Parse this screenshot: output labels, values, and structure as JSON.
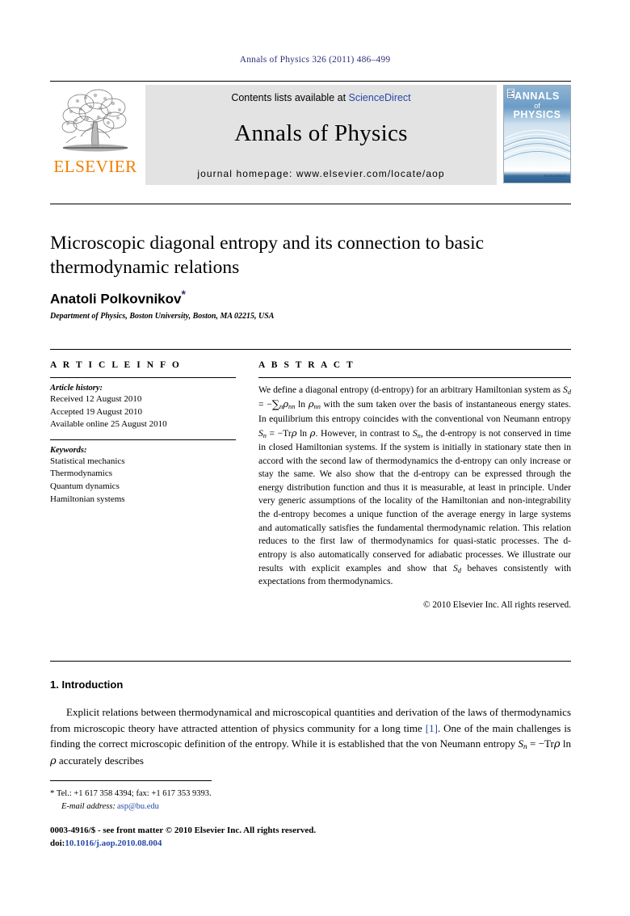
{
  "running_head": "Annals of Physics 326 (2011) 486–499",
  "masthead": {
    "contents_text": "Contents lists available at",
    "sciencedirect": "ScienceDirect",
    "journal_name": "Annals of Physics",
    "homepage_label": "journal homepage: www.elsevier.com/locate/aop",
    "publisher_wordmark": "ELSEVIER",
    "cover": {
      "line1": "ANNALS",
      "line2": "of",
      "line3": "PHYSICS",
      "badge": "ScienceDirect"
    }
  },
  "article": {
    "title": "Microscopic diagonal entropy and its connection to basic thermodynamic relations",
    "author": "Anatoli Polkovnikov",
    "author_marker": "*",
    "affiliation": "Department of Physics, Boston University, Boston, MA 02215, USA"
  },
  "info": {
    "heading": "A R T I C L E   I N F O",
    "history_label": "Article history:",
    "history": [
      "Received 12 August 2010",
      "Accepted 19 August 2010",
      "Available online 25 August 2010"
    ],
    "keywords_label": "Keywords:",
    "keywords": [
      "Statistical mechanics",
      "Thermodynamics",
      "Quantum dynamics",
      "Hamiltonian systems"
    ]
  },
  "abstract": {
    "heading": "A B S T R A C T",
    "part1": "We define a diagonal entropy (d-entropy) for an arbitrary Hamiltonian system as ",
    "formula1_lhs": "S",
    "formula1_lhs_sub": "d",
    "formula1_eq": " = −",
    "formula1_sum": "∑",
    "formula1_sum_sub": "n",
    "formula1_rho": "ρ",
    "formula1_rho_sub": "nn",
    "formula1_ln": " ln ",
    "formula1_rho2": "ρ",
    "formula1_rho2_sub": "nn",
    "part2": " with the sum taken over the basis of instantaneous energy states. In equilibrium this entropy coincides with the conventional von Neumann entropy ",
    "formula2_lhs": "S",
    "formula2_lhs_sub": "n",
    "formula2_eq": " = −Tr",
    "formula2_rho": "ρ",
    "formula2_ln": " ln ",
    "formula2_rho2": "ρ",
    "part3": ". However, in contrast to ",
    "formula3_lhs": "S",
    "formula3_lhs_sub": "n",
    "part4": ", the d-entropy is not conserved in time in closed Hamiltonian systems. If the system is initially in stationary state then in accord with the second law of thermodynamics the d-entropy can only increase or stay the same. We also show that the d-entropy can be expressed through the energy distribution function and thus it is measurable, at least in principle. Under very generic assumptions of the locality of the Hamiltonian and non-integrability the d-entropy becomes a unique function of the average energy in large systems and automatically satisfies the fundamental thermodynamic relation. This relation reduces to the first law of thermodynamics for quasi-static processes. The d-entropy is also automatically conserved for adiabatic processes. We illustrate our results with explicit examples and show that ",
    "formula4_lhs": "S",
    "formula4_lhs_sub": "d",
    "part5": " behaves consistently with expectations from thermodynamics.",
    "copyright": "© 2010 Elsevier Inc. All rights reserved."
  },
  "body": {
    "section_number_title": "1. Introduction",
    "paragraph_a": "Explicit relations between thermodynamical and microscopical quantities and derivation of the laws of thermodynamics from microscopic theory have attracted attention of physics community for a long time ",
    "citation": "[1]",
    "paragraph_b": ". One of the main challenges is finding the correct microscopic definition of the entropy. While it is established that the von Neumann entropy ",
    "formula_lhs": "S",
    "formula_lhs_sub": "n",
    "formula_eq": " = −Tr",
    "formula_rho": "ρ",
    "formula_ln": " ln ",
    "formula_rho2": "ρ",
    "paragraph_c": " accurately describes"
  },
  "footer": {
    "footnote_marker": "*",
    "footnote_contact": "Tel.: +1 617 358 4394; fax: +1 617 353 9393.",
    "email_label": "E-mail address:",
    "email": "asp@bu.edu",
    "issn_line": "0003-4916/$ - see front matter © 2010 Elsevier Inc. All rights reserved.",
    "doi_label": "doi:",
    "doi_value": "10.1016/j.aop.2010.08.004"
  },
  "colors": {
    "link": "#2449a8",
    "elsevier_orange": "#f07d00",
    "running_head": "#2f2f7a"
  }
}
